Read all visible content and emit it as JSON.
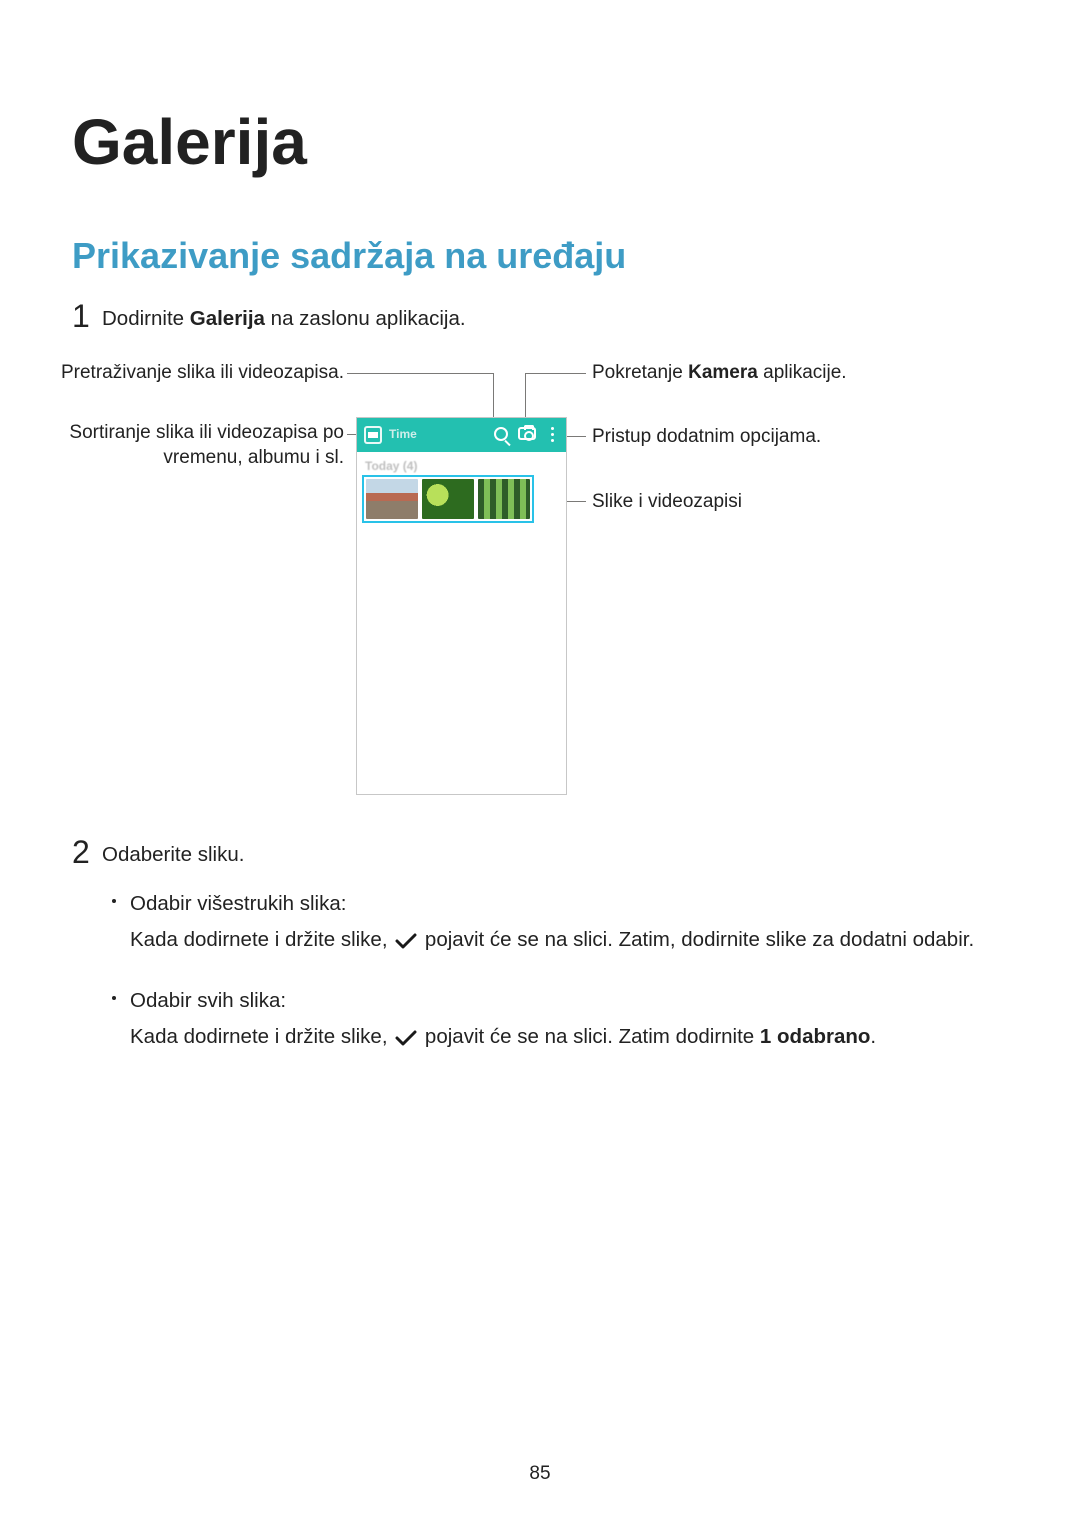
{
  "page": {
    "title": "Galerija",
    "subtitle": "Prikazivanje sadržaja na uređaju",
    "number": "85"
  },
  "steps": {
    "one": {
      "num": "1",
      "pre": "Dodirnite ",
      "bold": "Galerija",
      "post": " na zaslonu aplikacija."
    },
    "two": {
      "num": "2",
      "text": "Odaberite sliku."
    }
  },
  "callouts": {
    "search": "Pretraživanje slika ili videozapisa.",
    "sort": "Sortiranje slika ili videozapisa po vremenu, albumu i sl.",
    "camera_pre": "Pokretanje ",
    "camera_bold": "Kamera",
    "camera_post": " aplikacije.",
    "options": "Pristup dodatnim opcijama.",
    "thumbs": "Slike i videozapisi"
  },
  "phone": {
    "time_label": "Time",
    "subheader": "Today (4)"
  },
  "bullets": {
    "b1_title": "Odabir višestrukih slika:",
    "b1_pre": "Kada dodirnete i držite slike, ",
    "b1_post": " pojavit će se na slici. Zatim, dodirnite slike za dodatni odabir.",
    "b2_title": "Odabir svih slika:",
    "b2_pre": "Kada dodirnete i držite slike, ",
    "b2_mid": " pojavit će se na slici. Zatim dodirnite ",
    "b2_bold": "1 odabrano",
    "b2_post": "."
  }
}
